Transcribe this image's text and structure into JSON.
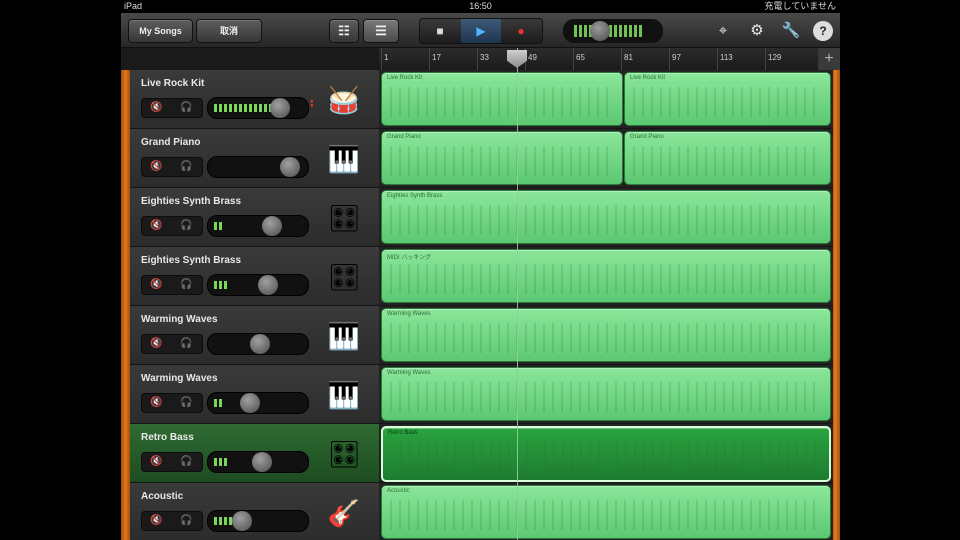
{
  "status": {
    "device": "iPad",
    "time": "16:50",
    "battery": "充電していません"
  },
  "toolbar": {
    "my_songs": "My Songs",
    "undo": "取消"
  },
  "ruler": {
    "marks": [
      "1",
      "17",
      "33",
      "49",
      "65",
      "81",
      "97",
      "113",
      "129"
    ]
  },
  "tracks": [
    {
      "name": "Live Rock Kit",
      "region": "Live Rock Kit",
      "region2": "Live Rock Kit",
      "level": 0.75
    },
    {
      "name": "Grand Piano",
      "region": "Grand Piano",
      "region2": "Grand Piano",
      "level": 0.0
    },
    {
      "name": "Eighties Synth Brass",
      "region": "Eighties Synth Brass",
      "level": 0.1
    },
    {
      "name": "Eighties Synth Brass",
      "region": "MIDI バッキング",
      "level": 0.2
    },
    {
      "name": "Warming Waves",
      "region": "Warming Waves",
      "level": 0.0
    },
    {
      "name": "Warming Waves",
      "region": "Warming Waves",
      "level": 0.1
    },
    {
      "name": "Retro Bass",
      "region": "Retro Bass",
      "level": 0.1
    },
    {
      "name": "Acoustic",
      "region": "Acoustic",
      "level": 0.3
    }
  ]
}
